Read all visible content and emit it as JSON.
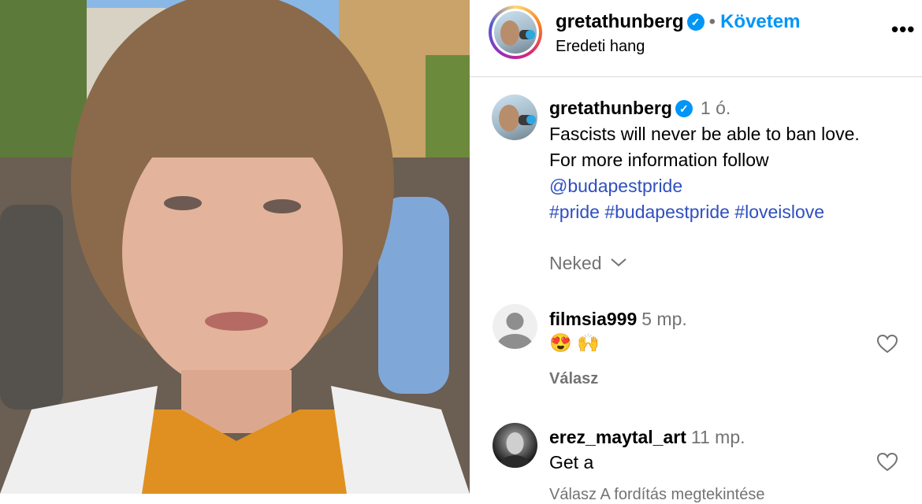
{
  "post": {
    "username": "gretathunberg",
    "separator": "•",
    "follow_label": "Követem",
    "audio_label": "Eredeti hang",
    "more_label": "•••"
  },
  "caption": {
    "username": "gretathunberg",
    "time": "1 ó.",
    "line1": "Fascists will never be able to ban love.",
    "line2": "For more information follow",
    "mention": "@budapestpride",
    "hashtags": "#pride #budapestpride #loveislove"
  },
  "sort_label": "Neked",
  "comments": [
    {
      "username": "filmsia999",
      "time": "5 mp.",
      "text": "😍 🙌",
      "reply_label": "Válasz"
    },
    {
      "username": "erez_maytal_art",
      "time": "11 mp.",
      "text": "Get a",
      "reply_label": "Válasz A fordítás megtekintése"
    }
  ],
  "colors": {
    "accent": "#0095f6",
    "link": "#2f4fbf",
    "muted": "#737373"
  },
  "icons": [
    "verified-badge-icon",
    "more-options-icon",
    "chevron-down-icon",
    "heart-icon",
    "default-avatar-icon"
  ]
}
